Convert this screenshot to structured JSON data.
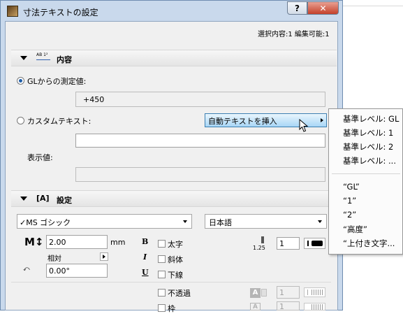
{
  "window": {
    "title": "寸法テキストの設定"
  },
  "titlebar": {
    "help_label": "?",
    "close_label": "✕"
  },
  "status": {
    "selection_info": "選択内容:1 編集可能:1"
  },
  "content_section": {
    "icon_text": "AB 1²",
    "title": "内容"
  },
  "gl_option": {
    "label": "GLからの測定値:",
    "selected": true,
    "value": "+450"
  },
  "custom_option": {
    "label": "カスタムテキスト:",
    "selected": false,
    "insert_button_label": "自動テキストを挿入"
  },
  "display_value": {
    "label": "表示値:"
  },
  "settings_section": {
    "icon_text": "[A]",
    "title": "設定"
  },
  "font": {
    "name": "✓MS ゴシック",
    "script": "日本語"
  },
  "size": {
    "value": "2.00",
    "unit": "mm",
    "relative_label": "相対",
    "angle": "0.00°"
  },
  "style": {
    "bold_icon": "B",
    "italic_icon": "I",
    "underline_icon": "U",
    "bold_label": "太字",
    "italic_label": "斜体",
    "underline_label": "下線",
    "opaque_label": "不透過",
    "frame_label": "枠"
  },
  "pen": {
    "weight_label": "1.25",
    "value": "1",
    "opaque_pen": "1",
    "frame_pen": "1"
  },
  "context_menu": {
    "items": [
      "基準レベル: GL",
      "基準レベル: 1",
      "基準レベル: 2",
      "基準レベル: ..."
    ],
    "quoted_items": [
      "“GL”",
      "“1”",
      "“2”",
      "“高度”",
      "“上付き文字..."
    ]
  },
  "colors": {
    "window_frame": "#c9d9ec",
    "client_bg": "#f0f0f0",
    "highlight": "#a8d6f6",
    "radio_dot": "#1f5ea8"
  }
}
